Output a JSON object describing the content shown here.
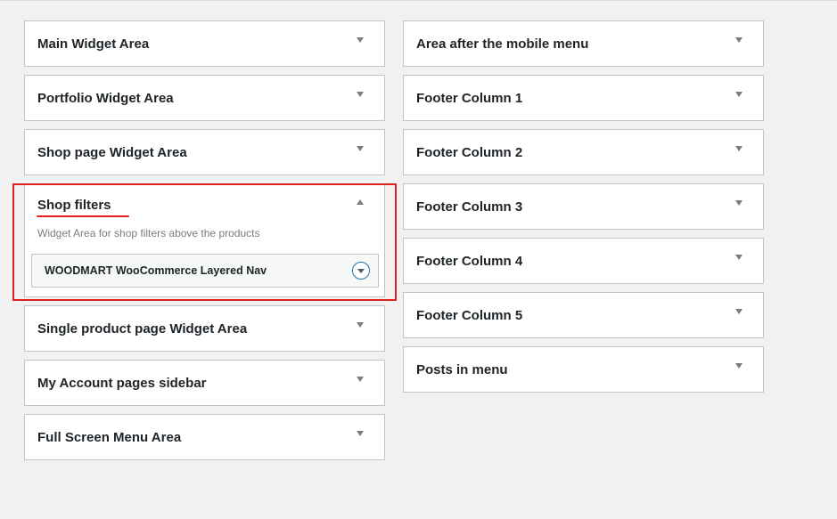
{
  "left_column": [
    {
      "title": "Main Widget Area",
      "expanded": false
    },
    {
      "title": "Portfolio Widget Area",
      "expanded": false
    },
    {
      "title": "Shop page Widget Area",
      "expanded": false
    },
    {
      "title": "Shop filters",
      "expanded": true,
      "description": "Widget Area for shop filters above the products",
      "widgets": [
        {
          "title": "WOODMART WooCommerce Layered Nav"
        }
      ]
    },
    {
      "title": "Single product page Widget Area",
      "expanded": false
    },
    {
      "title": "My Account pages sidebar",
      "expanded": false
    },
    {
      "title": "Full Screen Menu Area",
      "expanded": false
    }
  ],
  "right_column": [
    {
      "title": "Area after the mobile menu",
      "expanded": false
    },
    {
      "title": "Footer Column 1",
      "expanded": false
    },
    {
      "title": "Footer Column 2",
      "expanded": false
    },
    {
      "title": "Footer Column 3",
      "expanded": false
    },
    {
      "title": "Footer Column 4",
      "expanded": false
    },
    {
      "title": "Footer Column 5",
      "expanded": false
    },
    {
      "title": "Posts in menu",
      "expanded": false
    }
  ],
  "icons": {
    "collapsed_toggle": "chevron-down-icon",
    "expanded_toggle": "chevron-up-icon",
    "widget_toggle": "circle-chevron-down-icon"
  },
  "colors": {
    "annotation_red": "#e01e1e",
    "accent_blue": "#2271b1",
    "background": "#f1f1f1"
  }
}
